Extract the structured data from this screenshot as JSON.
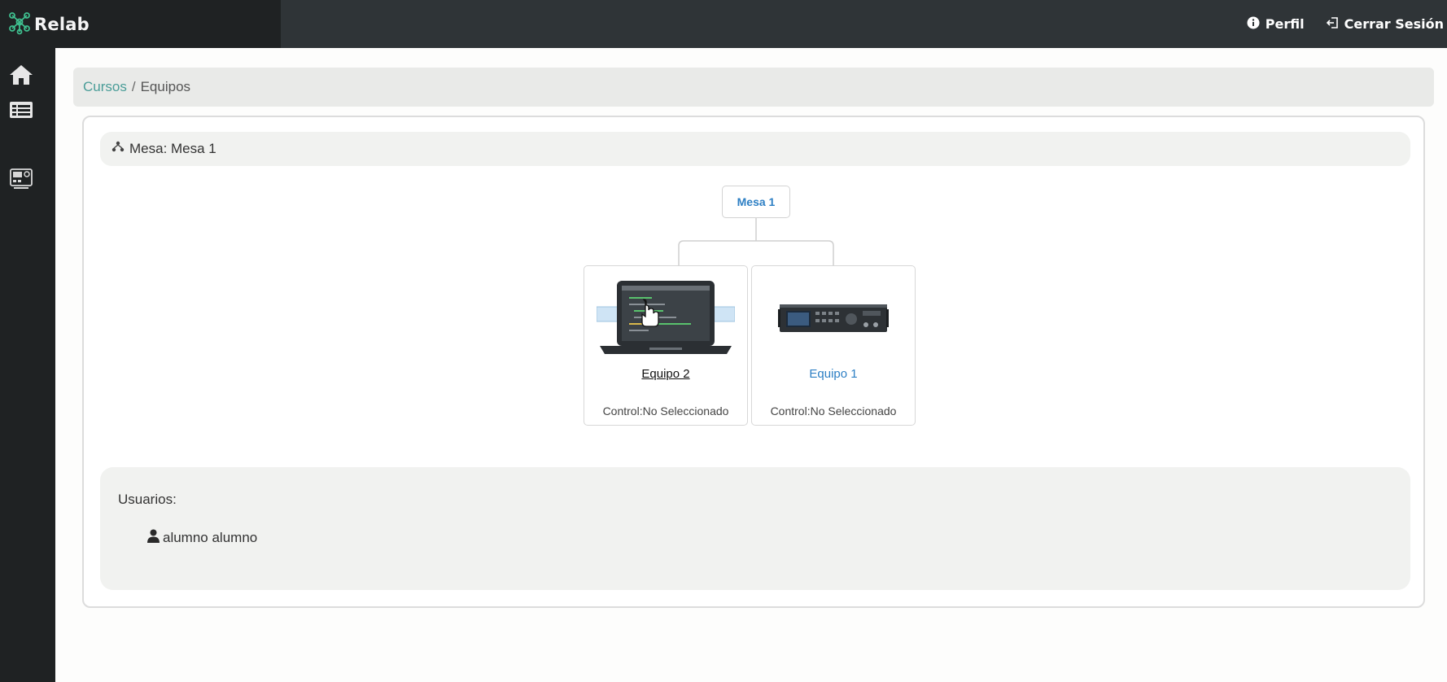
{
  "app": {
    "name": "Relab"
  },
  "header": {
    "profile_label": "Perfil",
    "logout_label": "Cerrar Sesión"
  },
  "sidebar": {
    "items": [
      {
        "icon": "home-icon"
      },
      {
        "icon": "list-icon"
      },
      {
        "icon": "lab-equipment-icon"
      }
    ]
  },
  "breadcrumb": {
    "link": "Cursos",
    "separator": "/",
    "current": "Equipos"
  },
  "mesa": {
    "header_label": "Mesa: Mesa 1",
    "root_label": "Mesa 1"
  },
  "equipos": [
    {
      "name": "Equipo 2",
      "control": "Control:No Seleccionado",
      "image": "laptop-image",
      "active": true
    },
    {
      "name": "Equipo 1",
      "control": "Control:No Seleccionado",
      "image": "instrument-image",
      "active": false
    }
  ],
  "users": {
    "title": "Usuarios:",
    "list": [
      "alumno alumno"
    ]
  },
  "colors": {
    "topbar": "#2f3437",
    "sidebar": "#1f2223",
    "link_teal": "#4a9d98",
    "link_blue": "#2d7fc4",
    "logo_green": "#3fbf8f"
  }
}
